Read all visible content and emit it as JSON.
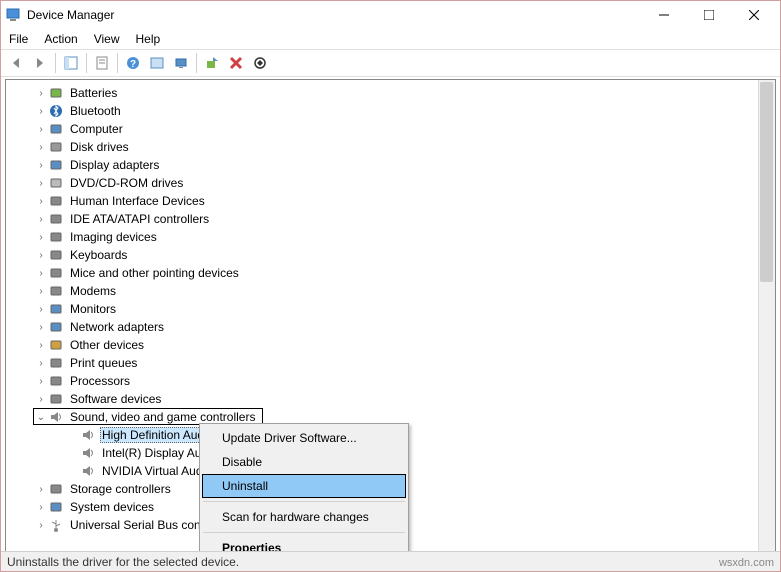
{
  "window": {
    "title": "Device Manager"
  },
  "menu": {
    "file": "File",
    "action": "Action",
    "view": "View",
    "help": "Help"
  },
  "tree": {
    "items": [
      {
        "label": "Batteries",
        "icon": "battery"
      },
      {
        "label": "Bluetooth",
        "icon": "bluetooth"
      },
      {
        "label": "Computer",
        "icon": "monitor"
      },
      {
        "label": "Disk drives",
        "icon": "disk"
      },
      {
        "label": "Display adapters",
        "icon": "display"
      },
      {
        "label": "DVD/CD-ROM drives",
        "icon": "cdrom"
      },
      {
        "label": "Human Interface Devices",
        "icon": "hid"
      },
      {
        "label": "IDE ATA/ATAPI controllers",
        "icon": "ide"
      },
      {
        "label": "Imaging devices",
        "icon": "camera"
      },
      {
        "label": "Keyboards",
        "icon": "keyboard"
      },
      {
        "label": "Mice and other pointing devices",
        "icon": "mouse"
      },
      {
        "label": "Modems",
        "icon": "modem"
      },
      {
        "label": "Monitors",
        "icon": "monitor"
      },
      {
        "label": "Network adapters",
        "icon": "network"
      },
      {
        "label": "Other devices",
        "icon": "other"
      },
      {
        "label": "Print queues",
        "icon": "printer"
      },
      {
        "label": "Processors",
        "icon": "cpu"
      },
      {
        "label": "Software devices",
        "icon": "software"
      },
      {
        "label": "Sound, video and game controllers",
        "icon": "sound",
        "expanded": true,
        "focused": true,
        "children": [
          {
            "label": "High Definition Audio Device",
            "icon": "speaker",
            "selected": true
          },
          {
            "label": "Intel(R) Display Audio",
            "icon": "speaker"
          },
          {
            "label": "NVIDIA Virtual Audio Device (",
            "icon": "speaker"
          }
        ]
      },
      {
        "label": "Storage controllers",
        "icon": "storage"
      },
      {
        "label": "System devices",
        "icon": "system"
      },
      {
        "label": "Universal Serial Bus controllers",
        "icon": "usb"
      }
    ]
  },
  "contextmenu": {
    "items": [
      {
        "label": "Update Driver Software...",
        "type": "item"
      },
      {
        "label": "Disable",
        "type": "item"
      },
      {
        "label": "Uninstall",
        "type": "item",
        "hover": true
      },
      {
        "type": "sep"
      },
      {
        "label": "Scan for hardware changes",
        "type": "item"
      },
      {
        "type": "sep"
      },
      {
        "label": "Properties",
        "type": "item",
        "bold": true
      }
    ]
  },
  "statusbar": {
    "text": "Uninstalls the driver for the selected device."
  },
  "watermark": "wsxdn.com"
}
